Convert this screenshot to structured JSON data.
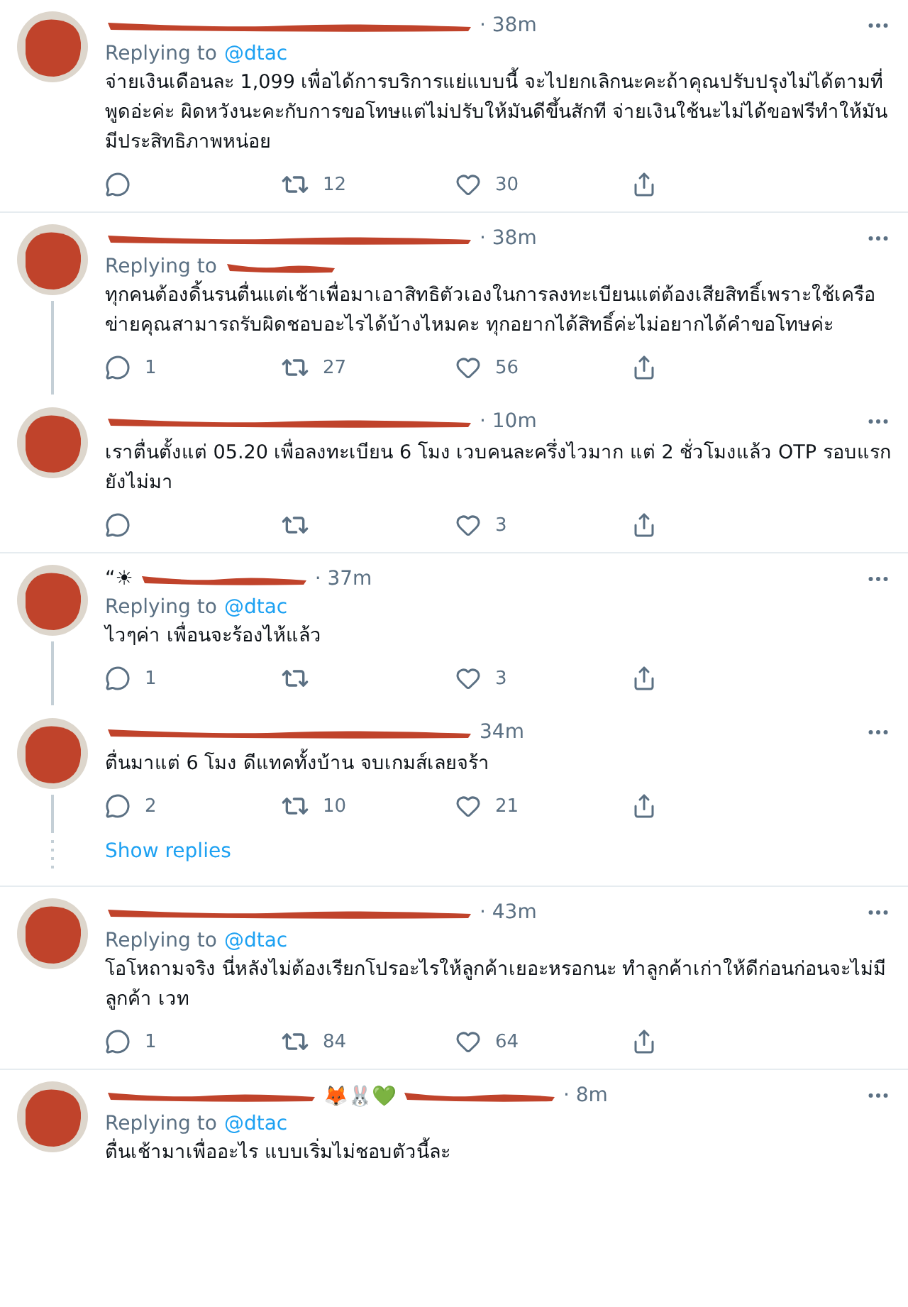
{
  "tweets": [
    {
      "name_redacted": true,
      "time": "· 38m",
      "replying": {
        "label": "Replying to",
        "handle": "@dtac"
      },
      "text": "จ่ายเงินเดือนละ 1,099 เพื่อได้การบริการแย่แบบนี้ จะไปยกเลิกนะคะถ้าคุณปรับปรุงไม่ได้ตามที่พูดอ่ะค่ะ ผิดหวังนะคะกับการขอโทษแต่ไม่ปรับให้มันดีขึ้นสักที จ่ายเงินใช้นะไม่ได้ขอฟรีทำให้มันมีประสิทธิภาพหน่อย",
      "retweets": "12",
      "likes": "30",
      "thread_line": false,
      "separator_after": true
    },
    {
      "name_redacted": true,
      "time": "· 38m",
      "replying": {
        "label": "Replying to",
        "redacted": true
      },
      "text": "ทุกคนต้องดิ้นรนตื่นแต่เช้าเพื่อมาเอาสิทธิตัวเองในการลงทะเบียนแต่ต้องเสียสิทธิ์เพราะใช้เครือข่ายคุณสามารถรับผิดชอบอะไรได้บ้างไหมคะ ทุกอยากได้สิทธิ์ค่ะไม่อยากได้คำขอโทษค่ะ",
      "replies": "1",
      "retweets": "27",
      "likes": "56",
      "thread_line": true,
      "separator_after": false
    },
    {
      "name_redacted": true,
      "time": "· 10m",
      "text": "เราตื่นตั้งแต่ 05.20 เพื่อลงทะเบียน 6 โมง เวบคนละครึ่งไวมาก แต่  2 ชั่วโมงแล้ว OTP รอบแรกยังไม่มา",
      "likes": "3",
      "thread_line": false,
      "separator_after": true
    },
    {
      "name_prefix": "“☀",
      "name_redacted": true,
      "time": "· 37m",
      "replying": {
        "label": "Replying to",
        "handle": "@dtac"
      },
      "text": "ไวๆค่า เพื่อนจะร้องไห้แล้ว",
      "replies": "1",
      "likes": "3",
      "thread_line": true,
      "separator_after": false
    },
    {
      "name_redacted": true,
      "time": "34m",
      "text": "ตื่นมาแต่ 6 โมง ดีแทคทั้งบ้าน จบเกมส์เลยจร้า",
      "replies": "2",
      "retweets": "10",
      "likes": "21",
      "thread_line": true,
      "separator_after": false,
      "show_replies": "Show replies"
    },
    {
      "name_redacted": true,
      "time": "· 43m",
      "replying": {
        "label": "Replying to",
        "handle": "@dtac"
      },
      "text": "โอโหถามจริง นี่หลังไม่ต้องเรียกโปรอะไรให้ลูกค้าเยอะหรอกนะ ทำลูกค้าเก่าให้ดีก่อนก่อนจะไม่มีลูกค้า เวท",
      "replies": "1",
      "retweets": "84",
      "likes": "64",
      "thread_line": false,
      "separator_after": true
    },
    {
      "name_redacted": true,
      "emoji": "🦊🐰💚",
      "time": "· 8m",
      "replying": {
        "label": "Replying to",
        "handle": "@dtac"
      },
      "text": "ตื่นเช้ามาเพื่ออะไร แบบเริ่มไม่ชอบตัวนี้ละ",
      "thread_line": false,
      "separator_after": false,
      "cut_off": true
    }
  ]
}
